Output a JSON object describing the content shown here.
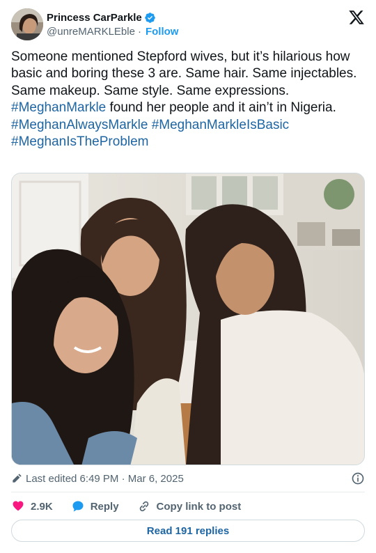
{
  "author": {
    "display_name": "Princess CarParkle",
    "handle": "@unreMARKLEble",
    "separator": "·",
    "follow_label": "Follow",
    "verified": true
  },
  "tweet": {
    "segments": [
      {
        "text": "Someone mentioned Stepford wives, but it’s hilarious how basic and boring these 3 are. Same hair. Same injectables. Same makeup. Same style. Same expressions. ",
        "type": "text"
      },
      {
        "text": "#MeghanMarkle",
        "type": "hashtag"
      },
      {
        "text": " found her people and it ain’t in Nigeria.",
        "type": "text"
      },
      {
        "text": "#MeghanAlwaysMarkle",
        "type": "hashtag",
        "newline_before": true
      },
      {
        "text": " ",
        "type": "text"
      },
      {
        "text": "#MeghanMarkleIsBasic",
        "type": "hashtag"
      },
      {
        "text": "#MeghanIsTheProblem",
        "type": "hashtag",
        "newline_before": true
      }
    ]
  },
  "meta": {
    "edited_text": "Last edited 6:49 PM · Mar 6, 2025"
  },
  "actions": {
    "likes": "2.9K",
    "reply_label": "Reply",
    "copy_label": "Copy link to post"
  },
  "read_replies_label": "Read 191 replies",
  "colors": {
    "link": "#1d65a3",
    "verified": "#1d9bf0",
    "like": "#f91880",
    "reply": "#1d9bf0"
  },
  "icons": [
    "verified-badge-icon",
    "x-logo-icon",
    "pencil-icon",
    "info-icon",
    "heart-icon",
    "reply-bubble-icon",
    "link-icon"
  ]
}
